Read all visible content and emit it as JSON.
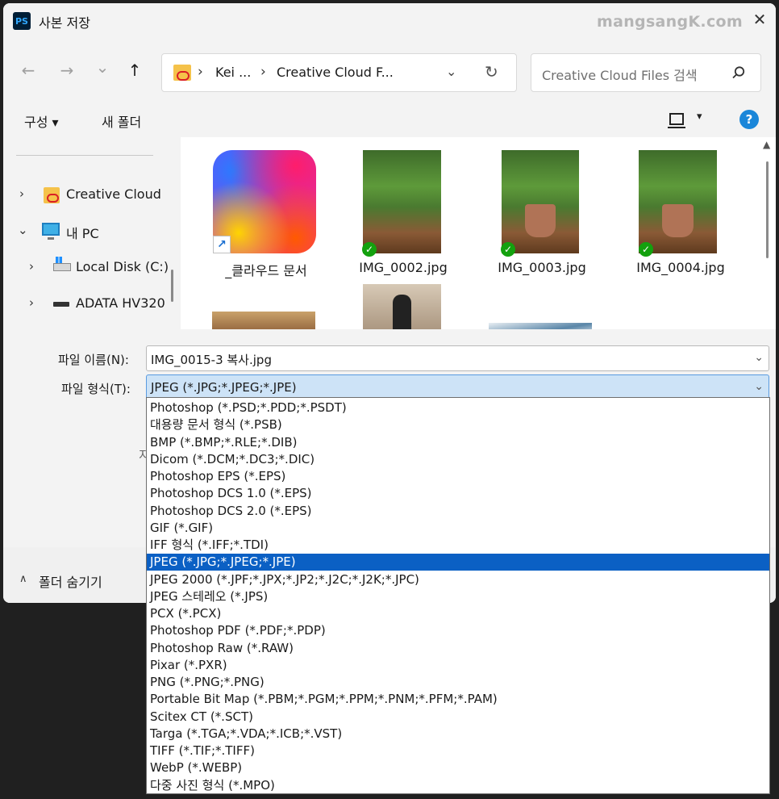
{
  "window": {
    "app_icon": "PS",
    "title": "사본 저장",
    "watermark": "mangsangK.com",
    "close_glyph": "✕"
  },
  "nav": {
    "back_glyph": "←",
    "forward_glyph": "→",
    "recent_glyph": "⌄",
    "up_glyph": "↑",
    "breadcrumb": [
      "Kei ...",
      "Creative Cloud F..."
    ],
    "breadcrumb_sep": "›",
    "search_placeholder": "Creative Cloud Files 검색"
  },
  "toolbar": {
    "organize_label": "구성 ▾",
    "new_folder_label": "새 폴더",
    "view_chevron": "▾",
    "help_glyph": "?"
  },
  "sidebar": {
    "items": [
      {
        "label": "Creative Cloud",
        "chevron": "›",
        "icon": "creative-cloud-folder-icon"
      },
      {
        "label": "내 PC",
        "chevron": "⌄",
        "icon": "pc-icon"
      },
      {
        "label": "Local Disk (C:)",
        "chevron": "›",
        "icon": "local-disk-icon"
      },
      {
        "label": "ADATA HV320",
        "chevron": "›",
        "icon": "external-drive-icon"
      }
    ]
  },
  "files": [
    {
      "name": "_클라우드 문서",
      "type": "shortcut"
    },
    {
      "name": "IMG_0002.jpg",
      "type": "photo",
      "synced": true
    },
    {
      "name": "IMG_0003.jpg",
      "type": "photo",
      "synced": true
    },
    {
      "name": "IMG_0004.jpg",
      "type": "photo",
      "synced": true
    }
  ],
  "form": {
    "filename_label": "파일 이름(N):",
    "filename_value": "IMG_0015-3 복사.jpg",
    "filetype_label": "파일 형식(T):",
    "filetype_value": "JPEG (*.JPG;*.JPEG;*.JPE)",
    "obscured_label_char": "지"
  },
  "footer": {
    "hide_folders_label": "폴더 숨기기",
    "hide_chevron": "∧"
  },
  "filetype_options": [
    "Photoshop (*.PSD;*.PDD;*.PSDT)",
    "대용량 문서 형식 (*.PSB)",
    "BMP (*.BMP;*.RLE;*.DIB)",
    "Dicom (*.DCM;*.DC3;*.DIC)",
    "Photoshop EPS (*.EPS)",
    "Photoshop DCS 1.0 (*.EPS)",
    "Photoshop DCS 2.0 (*.EPS)",
    "GIF (*.GIF)",
    "IFF 형식 (*.IFF;*.TDI)",
    "JPEG (*.JPG;*.JPEG;*.JPE)",
    "JPEG 2000 (*.JPF;*.JPX;*.JP2;*.J2C;*.J2K;*.JPC)",
    "JPEG 스테레오 (*.JPS)",
    "PCX (*.PCX)",
    "Photoshop PDF (*.PDF;*.PDP)",
    "Photoshop Raw (*.RAW)",
    "Pixar (*.PXR)",
    "PNG (*.PNG;*.PNG)",
    "Portable Bit Map (*.PBM;*.PGM;*.PPM;*.PNM;*.PFM;*.PAM)",
    "Scitex CT (*.SCT)",
    "Targa (*.TGA;*.VDA;*.ICB;*.VST)",
    "TIFF (*.TIF;*.TIFF)",
    "WebP (*.WEBP)",
    "다중 사진 형식 (*.MPO)"
  ],
  "selected_option_index": 9,
  "colors": {
    "accent": "#0b60c4",
    "sync_check": "#13a10e",
    "help": "#1a86d9"
  }
}
